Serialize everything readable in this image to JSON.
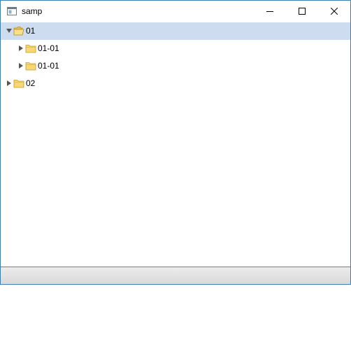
{
  "window": {
    "title": "samp",
    "app_icon": "window-app-icon",
    "controls": {
      "minimize_icon": "minimize-icon",
      "maximize_icon": "maximize-icon",
      "close_icon": "close-icon"
    },
    "accent": "#3c7fb1"
  },
  "tree": {
    "selection_color": "#cddcee",
    "nodes": [
      {
        "label": "01",
        "level": 0,
        "expanded": true,
        "selected": true
      },
      {
        "label": "01-01",
        "level": 1,
        "expanded": false,
        "selected": false
      },
      {
        "label": "01-01",
        "level": 1,
        "expanded": false,
        "selected": false
      },
      {
        "label": "02",
        "level": 0,
        "expanded": false,
        "selected": false
      }
    ]
  },
  "statusbar": {}
}
